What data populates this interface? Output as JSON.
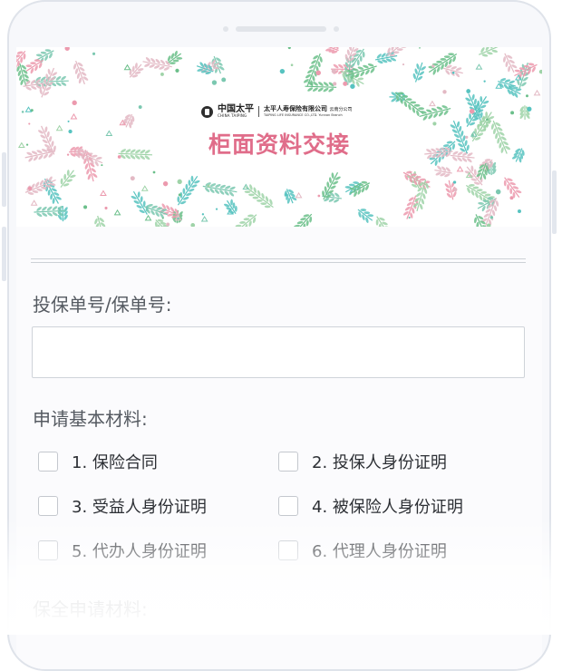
{
  "banner": {
    "logo_cn": "中国太平",
    "logo_en": "CHINA TAIPING",
    "company_cn": "太平人寿保险有限公司",
    "company_branch": "云南分公司",
    "company_en": "TAIPING LIFE INSURANCE CO.,LTD. Yunnan Branch",
    "title": "柜面资料交接"
  },
  "form": {
    "policy_label": "投保单号/保单号:",
    "policy_value": "",
    "basic_materials_label": "申请基本材料:",
    "basic_materials": [
      {
        "label": "1. 保险合同",
        "checked": false
      },
      {
        "label": "2. 投保人身份证明",
        "checked": false
      },
      {
        "label": "3. 受益人身份证明",
        "checked": false
      },
      {
        "label": "4. 被保险人身份证明",
        "checked": false
      },
      {
        "label": "5. 代办人身份证明",
        "checked": false
      },
      {
        "label": "6. 代理人身份证明",
        "checked": false
      }
    ],
    "preservation_label": "保全申请材料:"
  },
  "colors": {
    "title_pink": "#e06d8a",
    "leaf_green": "#6bbf8a",
    "leaf_teal": "#57c3c0",
    "leaf_pink": "#ec9aae"
  }
}
